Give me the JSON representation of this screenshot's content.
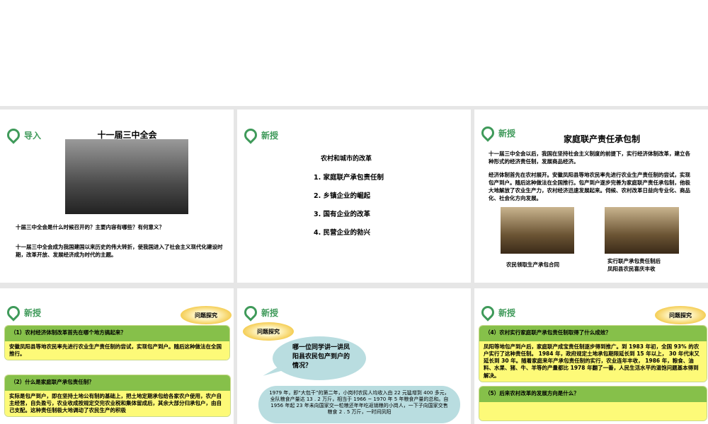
{
  "slides": {
    "s1": {
      "tag": "导入",
      "title": "十一届三中全会",
      "question": "十届三中全会是什么时候召开的？主要内容有哪些？有何意义？",
      "answer": "十一届三中全会成为我国建国以来历史的伟大转折，使我国进入了社会主义现代化建设时期，改革开放、发展经济成为时代的主题。"
    },
    "s2": {
      "tag": "新授",
      "title": "农村和城市的改革",
      "items": [
        "1. 家庭联产承包责任制",
        "2. 乡镇企业的崛起",
        "3. 国有企业的改革",
        "4. 民营企业的勃兴"
      ]
    },
    "s3": {
      "tag": "新授",
      "title": "家庭联产责任承包制",
      "p1": "十一届三中全会以后，我国在坚持社会主义制度的前提下，实行经济体制改革，建立各种形式的经济责任制，发展商品经济。",
      "p2": "经济体制首先在农村展开。安徽凤阳县等地农民率先进行农业生产责任制的尝试，实现包产到户。随后这种做法在全国推行。包产到户逐步完善为家庭联产责任承包制，他极大地解放了农业生产力，农村经济迅速发展起来。伺候、农村改革日益向专业化、商品化、社会化方向发展。",
      "cap1": "农民领取生产承包合同",
      "cap2a": "实行联产承包责任制后",
      "cap2b": "凤阳县农民喜庆丰收"
    },
    "s4": {
      "tag": "新授",
      "badge": "问题探究",
      "q1": "（1）农村经济体制改革首先在哪个地方搞起来？",
      "a1": "安徽凤阳县等地农民率先进行农业生产责任制的尝试，实现包产到户。随后这种做法在全国推行。",
      "q2": "（2）什么是家庭联产承包责任制？",
      "a2": "实际是包产到户，即在坚持土地公有制的基础上，把土地定期承包给各家农户使用，农户自主经营，自负盈亏，农业收成按规定交完农业税和集体留成后，其余大部分归承包户，由自己支配。这种责任制极大地调动了农民生产的积极"
    },
    "s5": {
      "tag": "新授",
      "badge": "问题探究",
      "bubble": "哪一位同学讲一讲凤阳县农民包产到户的情况？",
      "story": "1979 年，即“大包干”的第二年，小岗村农民人均收入由 22 元猛增到 400 多元，全队粮食产量达 13 . 2 万斤，相当于 1966 ~ 1970 年 5 年粮食产量的总和。自 1956 年起 23 年未向国家交一粒粮还年年吃返销粮的小岗人，一下子向国家交售粮食 2 . 5 万斤，一时间凤阳"
    },
    "s6": {
      "tag": "新授",
      "badge": "问题探究",
      "q4": "（4）农村实行家庭联产承包责任制取得了什么成效？",
      "a4": "凤阳等地包产到户后，家庭联产成宝责任制逐步得到推广。到 1983 年初，全国 93% 的农户实行了这种责任制。 1984 年，政府规定土地承包期限延长到 15 年以上， 30 年代末又延长到 30 年。随着家庭来年产承包责任制的实行，农业连年丰收， 1986 年，粮食、油料、水果、猪、牛、羊等的产量都比 1978 年翻了一番，人民生活水平的温饱问题基本得到解决。",
      "q5": "（5）后来农村改革的发展方向是什么？"
    }
  }
}
